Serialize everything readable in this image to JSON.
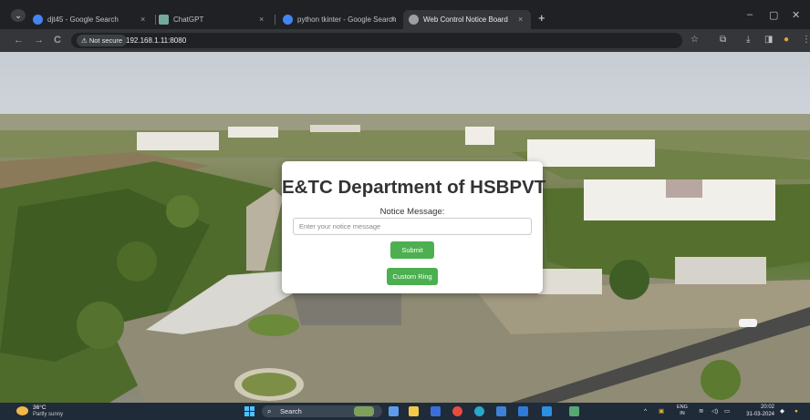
{
  "browser": {
    "tabs": [
      {
        "title": "djt45 - Google Search",
        "favicon_color": "#4285f4",
        "active": false
      },
      {
        "title": "ChatGPT",
        "favicon_color": "#74aa9c",
        "active": false
      },
      {
        "title": "python tkinter - Google Search",
        "favicon_color": "#4285f4",
        "active": false
      },
      {
        "title": "Web Control Notice Board",
        "favicon_color": "#9aa0a6",
        "active": true
      }
    ],
    "tab_close_glyph": "×",
    "new_tab_glyph": "+",
    "tab_search_glyph": "⌄",
    "window_controls": {
      "minimize": "–",
      "maximize": "▢",
      "close": "✕"
    },
    "nav": {
      "back": "←",
      "forward": "→",
      "reload": "C"
    },
    "security_label": "Not secure",
    "url": "192.168.1.11:8080",
    "toolbar_icons": {
      "bookmark": "☆",
      "extensions": "⧉",
      "download": "⤓",
      "sidepanel": "◨",
      "profile": "●",
      "menu": "⋮"
    }
  },
  "page": {
    "title": "E&TC Department of HSBPVT",
    "notice_label": "Notice Message:",
    "notice_input": {
      "value": "",
      "placeholder": "Enter your notice message"
    },
    "submit_label": "Submit",
    "custom_ring_label": "Custom Ring",
    "button_color": "#4caf50"
  },
  "taskbar": {
    "weather_temp": "36°C",
    "weather_desc": "Partly sunny",
    "search_label": "Search",
    "lang_line1": "ENG",
    "lang_line2": "IN",
    "time": "20:02",
    "date": "31-03-2024",
    "tray_overflow": "^"
  }
}
